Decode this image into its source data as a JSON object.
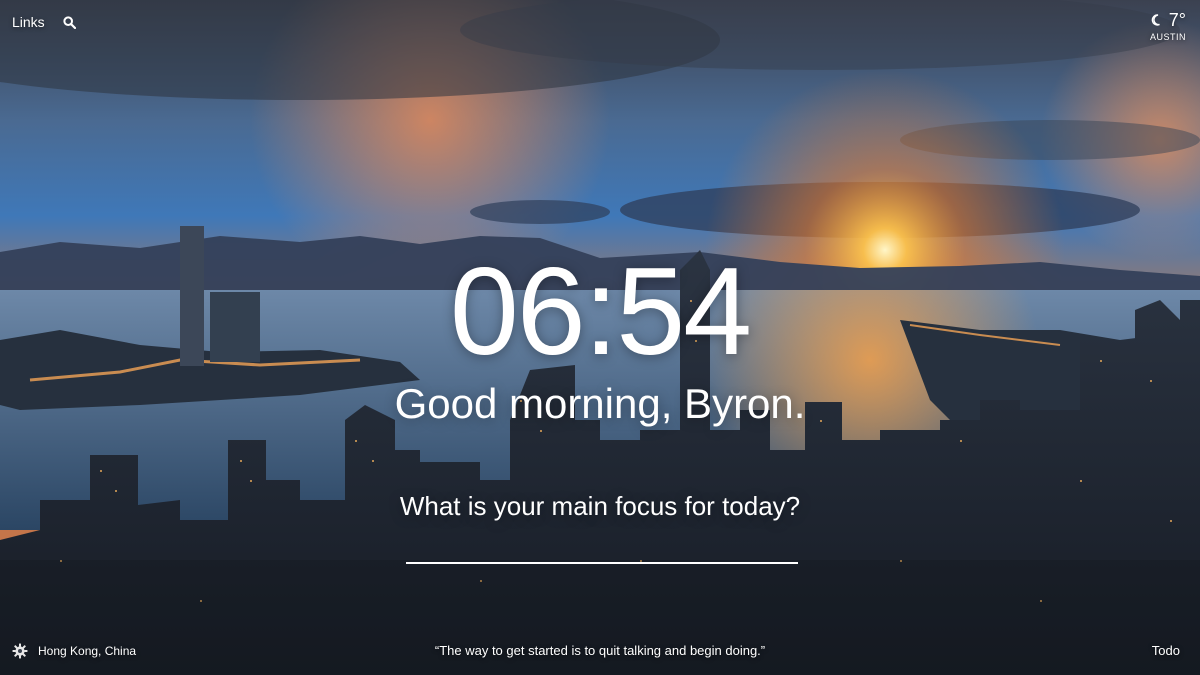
{
  "top_left": {
    "links_label": "Links",
    "search_icon": "search-icon"
  },
  "weather": {
    "icon": "moon-icon",
    "temperature": "7°",
    "location": "AUSTIN"
  },
  "clock": {
    "time": "06:54"
  },
  "greeting": {
    "text": "Good morning, Byron."
  },
  "focus": {
    "question": "What is your main focus for today?",
    "value": ""
  },
  "footer": {
    "settings_icon": "gear-icon",
    "photo_location": "Hong Kong, China",
    "quote": "“The way to get started is to quit talking and begin doing.”",
    "todo_label": "Todo"
  },
  "colors": {
    "text": "#ffffff",
    "sky_top": "#3a4f6e",
    "sky_mid": "#3f6ea8",
    "sunset": "#f08a2c",
    "water": "#3c5f86",
    "city_dark": "#1d2430"
  }
}
